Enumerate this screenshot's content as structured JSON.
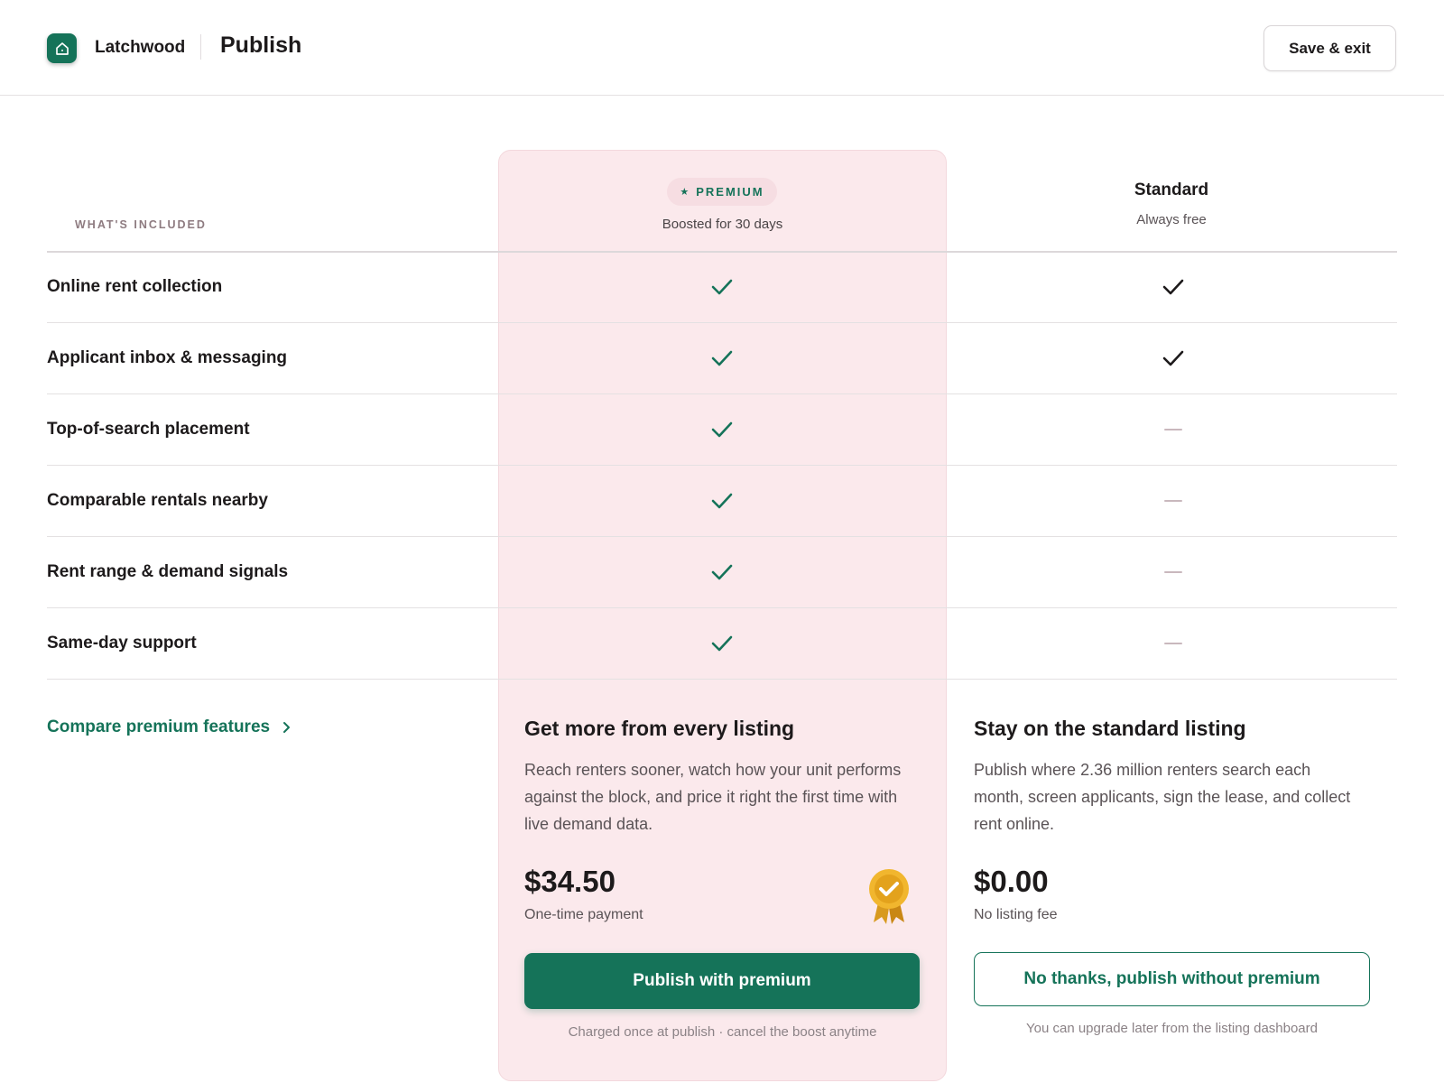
{
  "header": {
    "brand": "Latchwood",
    "title": "Publish",
    "save_label": "Save & exit",
    "logo_icon": "home-icon",
    "accent": "#157359"
  },
  "table": {
    "included_label": "WHAT'S INCLUDED",
    "premium": {
      "badge": "PREMIUM",
      "subtitle": "Boosted for 30 days"
    },
    "standard": {
      "title": "Standard",
      "subtitle": "Always free"
    },
    "features": [
      {
        "label": "Online rent collection",
        "premium": true,
        "standard": true
      },
      {
        "label": "Applicant inbox & messaging",
        "premium": true,
        "standard": true
      },
      {
        "label": "Top-of-search placement",
        "premium": true,
        "standard": false
      },
      {
        "label": "Comparable rentals nearby",
        "premium": true,
        "standard": false
      },
      {
        "label": "Rent range & demand signals",
        "premium": true,
        "standard": false
      },
      {
        "label": "Same-day support",
        "premium": true,
        "standard": false
      }
    ]
  },
  "compare_link": "Compare premium features",
  "premium_plan": {
    "title": "Get more from every listing",
    "description": "Reach renters sooner, watch how your unit performs against the block, and price it right the first time with live demand data.",
    "price": "$34.50",
    "price_note": "One-time payment",
    "cta": "Publish with premium",
    "fine_print": "Charged once at publish · cancel the boost anytime"
  },
  "standard_plan": {
    "title": "Stay on the standard listing",
    "description": "Publish where 2.36 million renters search each month, screen applicants, sign the lease, and collect rent online.",
    "price": "$0.00",
    "price_note": "No listing fee",
    "cta": "No thanks, publish without premium",
    "fine_print": "You can upgrade later from the listing dashboard"
  }
}
